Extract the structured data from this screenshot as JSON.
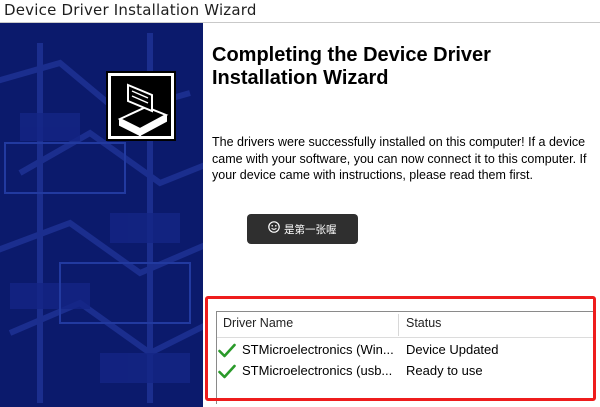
{
  "window": {
    "title": "Device Driver Installation Wizard"
  },
  "wizard": {
    "heading_line1": "Completing the Device Driver",
    "heading_line2": "Installation Wizard",
    "description": "The drivers were successfully installed on this computer! If a device came with your software, you can now connect it to this computer. If your device came with instructions, please read them first."
  },
  "toast": {
    "text": "是第一张喔",
    "icon": "smile-icon"
  },
  "driver_list": {
    "columns": [
      "Driver Name",
      "Status"
    ],
    "rows": [
      {
        "name": "STMicroelectronics (Win...",
        "status": "Device Updated",
        "icon": "checkmark-icon"
      },
      {
        "name": "STMicroelectronics (usb...",
        "status": "Ready to use",
        "icon": "checkmark-icon"
      }
    ]
  },
  "colors": {
    "sidebar": "#0b1a6c",
    "highlight_border": "#ee1c1c",
    "check": "#2a9a2a"
  }
}
